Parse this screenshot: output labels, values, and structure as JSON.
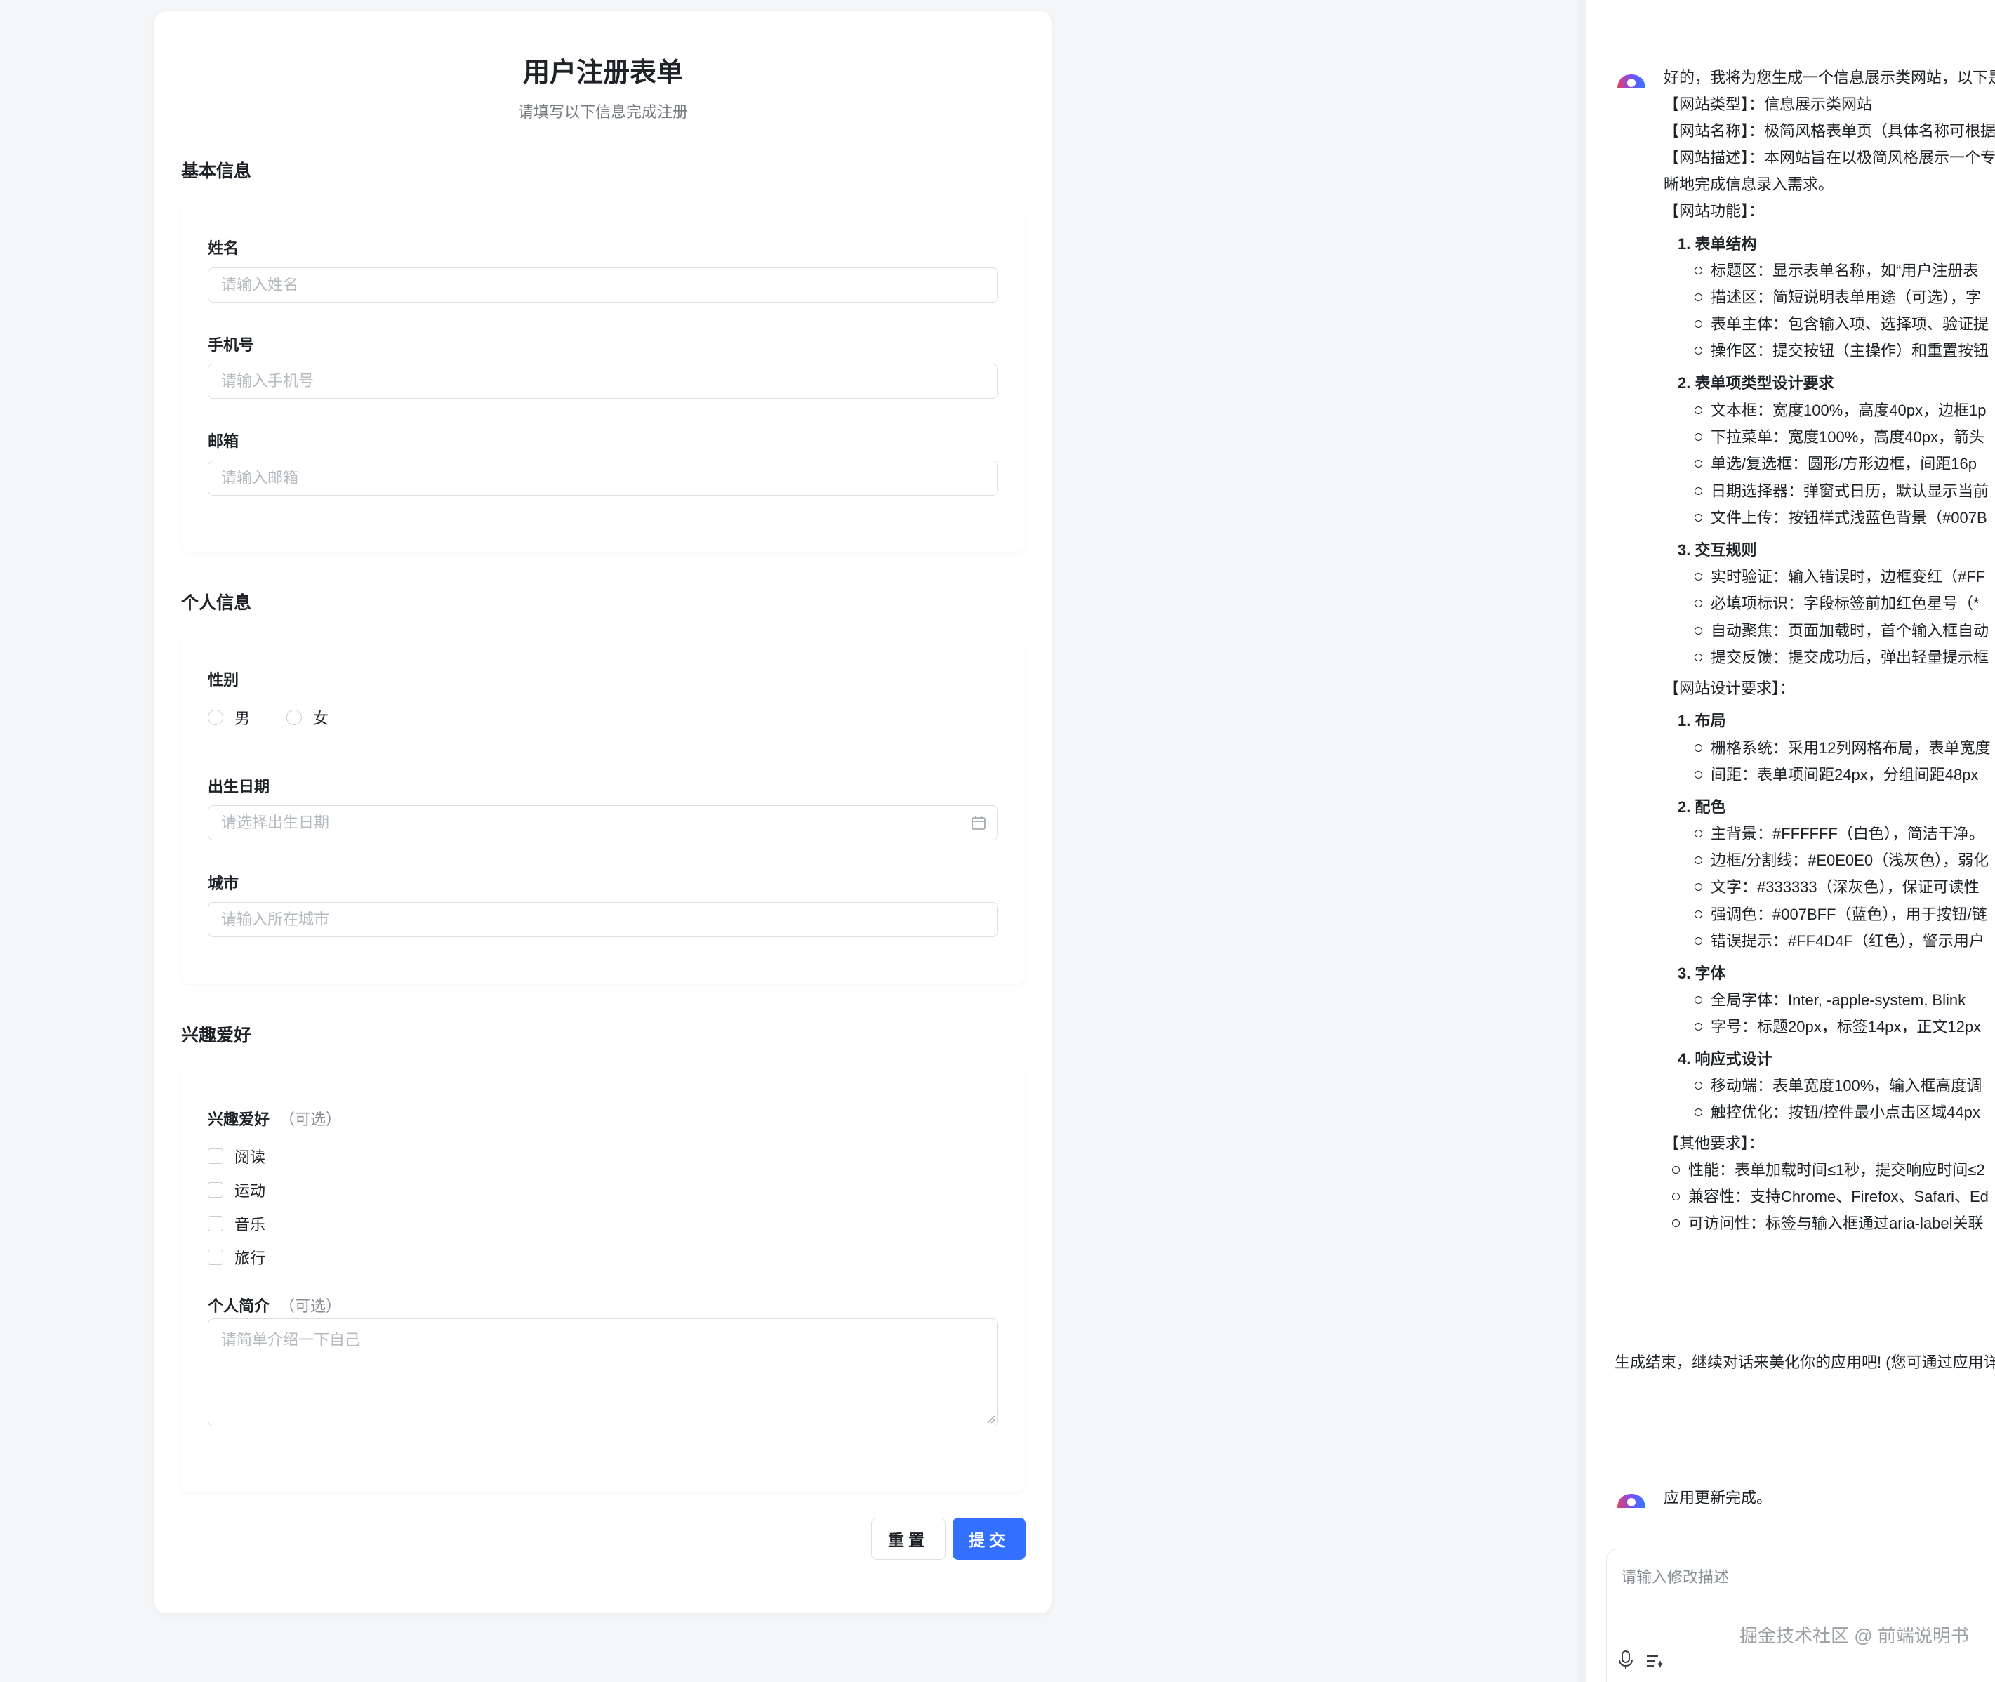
{
  "form": {
    "title": "用户注册表单",
    "subtitle": "请填写以下信息完成注册",
    "sections": {
      "basic": {
        "title": "基本信息",
        "name_label": "姓名",
        "name_placeholder": "请输入姓名",
        "phone_label": "手机号",
        "phone_placeholder": "请输入手机号",
        "email_label": "邮箱",
        "email_placeholder": "请输入邮箱"
      },
      "personal": {
        "title": "个人信息",
        "gender_label": "性别",
        "gender_options": [
          "男",
          "女"
        ],
        "birthday_label": "出生日期",
        "birthday_placeholder": "请选择出生日期",
        "city_label": "城市",
        "city_placeholder": "请输入所在城市"
      },
      "hobbies": {
        "title": "兴趣爱好",
        "hobby_label": "兴趣爱好",
        "optional": "（可选）",
        "hobby_options": [
          "阅读",
          "运动",
          "音乐",
          "旅行"
        ],
        "bio_label": "个人简介",
        "bio_placeholder": "请简单介绍一下自己"
      }
    },
    "buttons": {
      "reset": "重置",
      "submit": "提交"
    },
    "colors": {
      "primary": "#3370ff"
    }
  },
  "chat": {
    "message1": {
      "intro": "好的，我将为您生成一个信息展示类网站，以下是",
      "type": "【网站类型】：信息展示类网站",
      "name": "【网站名称】：极简风格表单页（具体名称可根据",
      "desc1": "【网站描述】：本网站旨在以极简风格展示一个专",
      "desc2": "晰地完成信息录入需求。",
      "features_title": "【网站功能】：",
      "g1_title": "1. 表单结构",
      "g1": [
        "标题区：显示表单名称，如“用户注册表",
        "描述区：简短说明表单用途（可选），字",
        "表单主体：包含输入项、选择项、验证提",
        "操作区：提交按钮（主操作）和重置按钮"
      ],
      "g2_title": "2. 表单项类型设计要求",
      "g2": [
        "文本框：宽度100%，高度40px，边框1p",
        "下拉菜单：宽度100%，高度40px，箭头",
        "单选/复选框：圆形/方形边框，间距16p",
        "日期选择器：弹窗式日历，默认显示当前",
        "文件上传：按钮样式浅蓝色背景（#007B"
      ],
      "g3_title": "3. 交互规则",
      "g3": [
        "实时验证：输入错误时，边框变红（#FF",
        "必填项标识：字段标签前加红色星号（*",
        "自动聚焦：页面加载时，首个输入框自动",
        "提交反馈：提交成功后，弹出轻量提示框"
      ],
      "design_title": "【网站设计要求】：",
      "d1_title": "1. 布局",
      "d1": [
        "栅格系统：采用12列网格布局，表单宽度",
        "间距：表单项间距24px，分组间距48px"
      ],
      "d2_title": "2. 配色",
      "d2": [
        "主背景：#FFFFFF（白色），简洁干净。",
        "边框/分割线：#E0E0E0（浅灰色），弱化",
        "文字：#333333（深灰色），保证可读性",
        "强调色：#007BFF（蓝色），用于按钮/链",
        "错误提示：#FF4D4F（红色），警示用户"
      ],
      "d3_title": "3. 字体",
      "d3": [
        "全局字体：Inter, -apple-system, Blink",
        "字号：标题20px，标签14px，正文12px"
      ],
      "d4_title": "4. 响应式设计",
      "d4": [
        "移动端：表单宽度100%，输入框高度调",
        "触控优化：按钮/控件最小点击区域44px"
      ],
      "other_title": "【其他要求】：",
      "other": [
        "性能：表单加载时间≤1秒，提交响应时间≤2",
        "兼容性：支持Chrome、Firefox、Safari、Ed",
        "可访问性：标签与输入框通过aria-label关联"
      ]
    },
    "done_text": "生成结束，继续对话来美化你的应用吧! (您可通过应用详",
    "message2": "应用更新完成。",
    "input_placeholder": "请输入修改描述",
    "watermark": "掘金技术社区 @ 前端说明书"
  }
}
